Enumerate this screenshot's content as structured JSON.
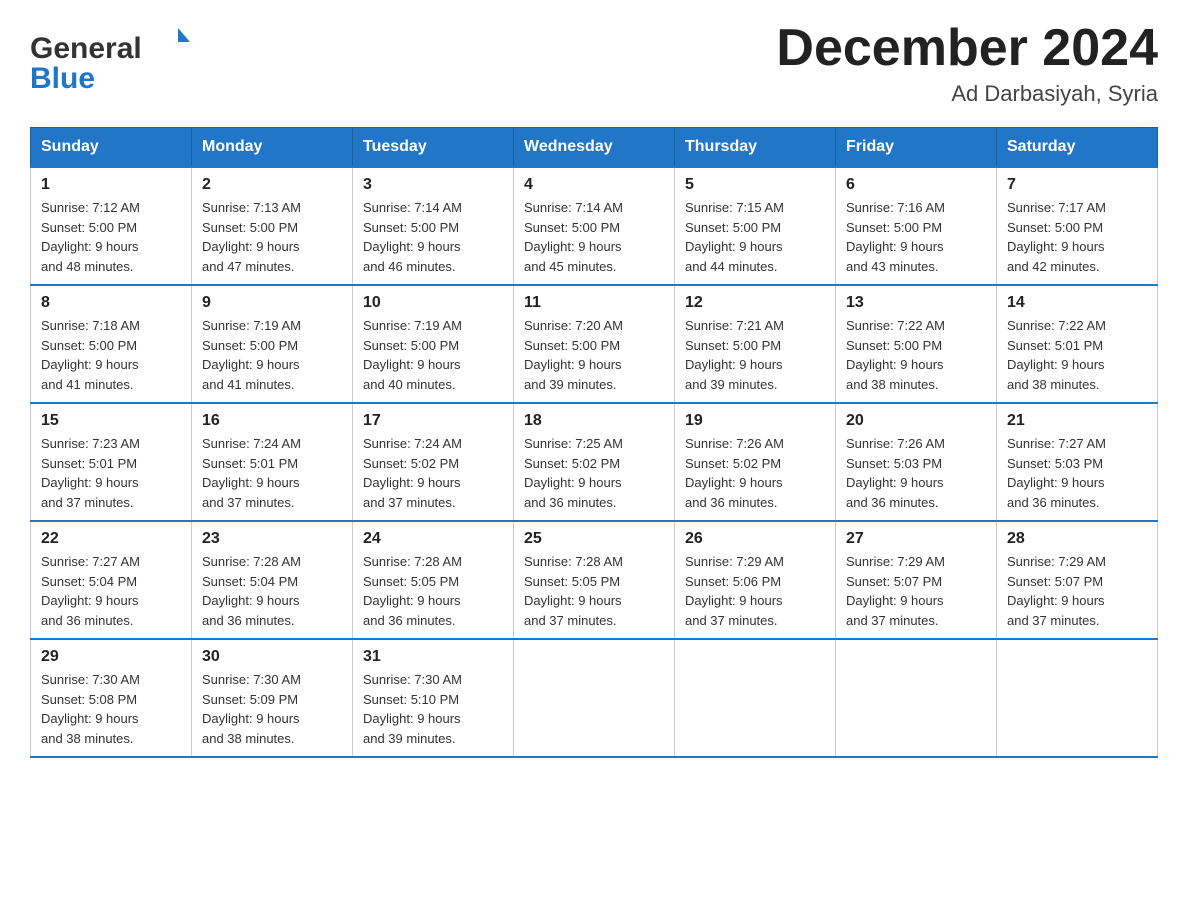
{
  "header": {
    "logo_general": "General",
    "logo_blue": "Blue",
    "month_title": "December 2024",
    "location": "Ad Darbasiyah, Syria"
  },
  "weekdays": [
    "Sunday",
    "Monday",
    "Tuesday",
    "Wednesday",
    "Thursday",
    "Friday",
    "Saturday"
  ],
  "weeks": [
    [
      {
        "day": "1",
        "sunrise": "7:12 AM",
        "sunset": "5:00 PM",
        "daylight": "9 hours and 48 minutes."
      },
      {
        "day": "2",
        "sunrise": "7:13 AM",
        "sunset": "5:00 PM",
        "daylight": "9 hours and 47 minutes."
      },
      {
        "day": "3",
        "sunrise": "7:14 AM",
        "sunset": "5:00 PM",
        "daylight": "9 hours and 46 minutes."
      },
      {
        "day": "4",
        "sunrise": "7:14 AM",
        "sunset": "5:00 PM",
        "daylight": "9 hours and 45 minutes."
      },
      {
        "day": "5",
        "sunrise": "7:15 AM",
        "sunset": "5:00 PM",
        "daylight": "9 hours and 44 minutes."
      },
      {
        "day": "6",
        "sunrise": "7:16 AM",
        "sunset": "5:00 PM",
        "daylight": "9 hours and 43 minutes."
      },
      {
        "day": "7",
        "sunrise": "7:17 AM",
        "sunset": "5:00 PM",
        "daylight": "9 hours and 42 minutes."
      }
    ],
    [
      {
        "day": "8",
        "sunrise": "7:18 AM",
        "sunset": "5:00 PM",
        "daylight": "9 hours and 41 minutes."
      },
      {
        "day": "9",
        "sunrise": "7:19 AM",
        "sunset": "5:00 PM",
        "daylight": "9 hours and 41 minutes."
      },
      {
        "day": "10",
        "sunrise": "7:19 AM",
        "sunset": "5:00 PM",
        "daylight": "9 hours and 40 minutes."
      },
      {
        "day": "11",
        "sunrise": "7:20 AM",
        "sunset": "5:00 PM",
        "daylight": "9 hours and 39 minutes."
      },
      {
        "day": "12",
        "sunrise": "7:21 AM",
        "sunset": "5:00 PM",
        "daylight": "9 hours and 39 minutes."
      },
      {
        "day": "13",
        "sunrise": "7:22 AM",
        "sunset": "5:00 PM",
        "daylight": "9 hours and 38 minutes."
      },
      {
        "day": "14",
        "sunrise": "7:22 AM",
        "sunset": "5:01 PM",
        "daylight": "9 hours and 38 minutes."
      }
    ],
    [
      {
        "day": "15",
        "sunrise": "7:23 AM",
        "sunset": "5:01 PM",
        "daylight": "9 hours and 37 minutes."
      },
      {
        "day": "16",
        "sunrise": "7:24 AM",
        "sunset": "5:01 PM",
        "daylight": "9 hours and 37 minutes."
      },
      {
        "day": "17",
        "sunrise": "7:24 AM",
        "sunset": "5:02 PM",
        "daylight": "9 hours and 37 minutes."
      },
      {
        "day": "18",
        "sunrise": "7:25 AM",
        "sunset": "5:02 PM",
        "daylight": "9 hours and 36 minutes."
      },
      {
        "day": "19",
        "sunrise": "7:26 AM",
        "sunset": "5:02 PM",
        "daylight": "9 hours and 36 minutes."
      },
      {
        "day": "20",
        "sunrise": "7:26 AM",
        "sunset": "5:03 PM",
        "daylight": "9 hours and 36 minutes."
      },
      {
        "day": "21",
        "sunrise": "7:27 AM",
        "sunset": "5:03 PM",
        "daylight": "9 hours and 36 minutes."
      }
    ],
    [
      {
        "day": "22",
        "sunrise": "7:27 AM",
        "sunset": "5:04 PM",
        "daylight": "9 hours and 36 minutes."
      },
      {
        "day": "23",
        "sunrise": "7:28 AM",
        "sunset": "5:04 PM",
        "daylight": "9 hours and 36 minutes."
      },
      {
        "day": "24",
        "sunrise": "7:28 AM",
        "sunset": "5:05 PM",
        "daylight": "9 hours and 36 minutes."
      },
      {
        "day": "25",
        "sunrise": "7:28 AM",
        "sunset": "5:05 PM",
        "daylight": "9 hours and 37 minutes."
      },
      {
        "day": "26",
        "sunrise": "7:29 AM",
        "sunset": "5:06 PM",
        "daylight": "9 hours and 37 minutes."
      },
      {
        "day": "27",
        "sunrise": "7:29 AM",
        "sunset": "5:07 PM",
        "daylight": "9 hours and 37 minutes."
      },
      {
        "day": "28",
        "sunrise": "7:29 AM",
        "sunset": "5:07 PM",
        "daylight": "9 hours and 37 minutes."
      }
    ],
    [
      {
        "day": "29",
        "sunrise": "7:30 AM",
        "sunset": "5:08 PM",
        "daylight": "9 hours and 38 minutes."
      },
      {
        "day": "30",
        "sunrise": "7:30 AM",
        "sunset": "5:09 PM",
        "daylight": "9 hours and 38 minutes."
      },
      {
        "day": "31",
        "sunrise": "7:30 AM",
        "sunset": "5:10 PM",
        "daylight": "9 hours and 39 minutes."
      },
      null,
      null,
      null,
      null
    ]
  ],
  "labels": {
    "sunrise": "Sunrise:",
    "sunset": "Sunset:",
    "daylight": "Daylight:"
  }
}
